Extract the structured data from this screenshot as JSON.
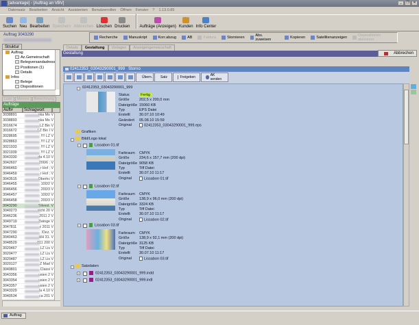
{
  "window": {
    "title": "[advantage] - [Auftrag an VBV]",
    "controls": [
      "_",
      "❐",
      "✕"
    ]
  },
  "menu": [
    "Datensatz",
    "Bearbeiten",
    "Ansicht",
    "Assistenten",
    "Benutzerrollen",
    "Öffnen",
    "Fenster",
    "?",
    "1.13.0.85"
  ],
  "toolbar": [
    {
      "label": "Suchen",
      "enabled": true,
      "color": "#6a8ad0"
    },
    {
      "label": "Neu",
      "enabled": true,
      "color": "#90b8e8"
    },
    {
      "label": "Bearbeiten",
      "enabled": true,
      "color": "#7aa0c0"
    },
    {
      "label": "Speichern",
      "enabled": false,
      "color": "#c0c0c0"
    },
    {
      "label": "Abbrechen",
      "enabled": false,
      "color": "#c0c0c0"
    },
    {
      "label": "Löschen",
      "enabled": true,
      "color": "#e03030"
    },
    {
      "label": "Drucken",
      "enabled": true,
      "color": "#8a8a8a"
    },
    {
      "label": "Aufträge (Anzeigen)",
      "enabled": true,
      "color": "#c04ab0"
    },
    {
      "label": "Kunden",
      "enabled": true,
      "color": "#d0902a"
    },
    {
      "label": "Info Center",
      "enabled": true,
      "color": "#4a80d0"
    }
  ],
  "order": {
    "title": "Auftrag 3043290"
  },
  "toolbar2": [
    {
      "label": "Recherche",
      "enabled": true
    },
    {
      "label": "Manuskript",
      "enabled": true
    },
    {
      "label": "Korr.abzug",
      "enabled": true
    },
    {
      "label": "AB",
      "enabled": true
    },
    {
      "label": "Faktura",
      "enabled": false
    },
    {
      "label": "Stornieren",
      "enabled": true
    },
    {
      "label": "Abs. zuweisen",
      "enabled": true
    },
    {
      "label": "Kopieren",
      "enabled": true
    },
    {
      "label": "Satellitenanzeigen",
      "enabled": true
    },
    {
      "label": "Dispositionen aktivieren",
      "enabled": false
    }
  ],
  "left": {
    "tab": "Struktur",
    "tree": [
      {
        "label": "Auftrag",
        "level": 0
      },
      {
        "label": "Az.Gemeinschaft",
        "level": 1
      },
      {
        "label": "Belegversandadress",
        "level": 1
      },
      {
        "label": "Positionen  (1)",
        "level": 1
      },
      {
        "label": "Details",
        "level": 1
      },
      {
        "label": "Infos",
        "level": 0
      },
      {
        "label": "Belege",
        "level": 1
      },
      {
        "label": "Dispositionen",
        "level": 1
      }
    ],
    "tabs2": [
      "Liste",
      "Memos",
      "Berechnung"
    ],
    "list_title": "Aufträge",
    "columns": [
      "Auft#",
      "Schlagwort"
    ],
    "rows": [
      [
        "3038891",
        "nka Mo V"
      ],
      [
        "3038893",
        "nka Mo V"
      ],
      [
        "3016674",
        "LZ Bin V"
      ],
      [
        "3016672",
        "LZ Bin I V"
      ],
      [
        "3028695",
        "!!!! LZ V"
      ],
      [
        "3028863",
        "!!!! LZ V"
      ],
      [
        "3021933",
        "!!!! LZ V"
      ],
      [
        "3021939",
        "!!!! LZ V"
      ],
      [
        "3043330",
        "da 4.10 V"
      ],
      [
        "3042607",
        "200/6 ; V"
      ],
      [
        "3046460",
        "r Hof ; V"
      ],
      [
        "3046459",
        "r Hof ; V"
      ],
      [
        "3043515",
        "Oberhc V"
      ],
      [
        "3046455",
        "100/2 V"
      ],
      [
        "3046456",
        "200/3 V"
      ],
      [
        "3046457",
        "100/2 V"
      ],
      [
        "3046458",
        "200/3 V"
      ],
      [
        "3043290",
        "Silvest. V"
      ],
      [
        "3040273",
        "sicht 20 V"
      ],
      [
        "3046236",
        "2011 2 V"
      ],
      [
        "3049719",
        "Zwinge V"
      ],
      [
        "3047811",
        "z 2011 V"
      ],
      [
        "3047290",
        "/Dez. V"
      ],
      [
        "3040463",
        "HH 31. V"
      ],
      [
        "3048529",
        "011 200 V"
      ],
      [
        "3020467",
        "LZ Lis V"
      ],
      [
        "3020477",
        "LZ Lis V"
      ],
      [
        "3020487",
        "LZ Lis V"
      ],
      [
        "3020127",
        "Z Mad V"
      ],
      [
        "3049801",
        "Classi V"
      ],
      [
        "3043356",
        "usien 2 V"
      ],
      [
        "3043354",
        "usien 2 V"
      ],
      [
        "3043357",
        "usien 2 V"
      ],
      [
        "3043329",
        "la 4.10 V"
      ],
      [
        "3040534",
        "ca 201 V"
      ]
    ],
    "selected": "3043290"
  },
  "taskbar": {
    "item": "Auftrag"
  },
  "right": {
    "tabs": [
      "Details",
      "Gestaltung",
      "Vorlagen",
      "Anzeigengemeinschaft"
    ],
    "active_tab": "Gestaltung",
    "section_title": "Gestaltung",
    "cancel": "Abbrechen",
    "header": {
      "name": "02412353_03043290001_999",
      "status": "Storno"
    },
    "actions": [
      "Übern.",
      "Satz",
      "Freigeben",
      "AK senden"
    ],
    "main": {
      "name": "02412353_03043290001_999",
      "fields": [
        [
          "Status",
          "Fertig"
        ],
        [
          "Größe",
          "202,5 x 200,0 mm"
        ],
        [
          "Dateigröße",
          "15060 KB"
        ],
        [
          "Typ",
          "EPS Datei"
        ],
        [
          "Erstellt",
          "30.07.10 10:49"
        ],
        [
          "Geändert",
          "05.08.10 15:59"
        ],
        [
          "Original",
          "02412353_03043290001_999.eps"
        ]
      ]
    },
    "folders": {
      "grafiken": "Grafiken",
      "bild": "Bild/Logo lokal",
      "satz": "Satzdaten"
    },
    "images": [
      {
        "name": "Lissabon 01.tif",
        "fields": [
          [
            "Farbraum",
            "CMYK"
          ],
          [
            "Größe",
            "234,6 x 157,7 mm (200 dpi)"
          ],
          [
            "Dateigröße",
            "9058 KB"
          ],
          [
            "Typ",
            "Tiff Datei"
          ],
          [
            "Erstellt",
            "30.07.10 11:17"
          ],
          [
            "Original",
            "Lissabon 01.tif"
          ]
        ]
      },
      {
        "name": "Lissabon 02.tif",
        "fields": [
          [
            "Farbraum",
            "CMYK"
          ],
          [
            "Größe",
            "138,9 x 96,0 mm (200 dpi)"
          ],
          [
            "Dateigröße",
            "3324 KB"
          ],
          [
            "Typ",
            "Tiff Datei"
          ],
          [
            "Erstellt",
            "30.07.10 11:17"
          ],
          [
            "Original",
            "Lissabon 02.tif"
          ]
        ]
      },
      {
        "name": "Lissabon 03.tif",
        "fields": [
          [
            "Farbraum",
            "CMYK"
          ],
          [
            "Größe",
            "138,9 x 92,1 mm (200 dpi)"
          ],
          [
            "Dateigröße",
            "3125 KB"
          ],
          [
            "Typ",
            "Tiff Datei"
          ],
          [
            "Erstellt",
            "30.07.10 11:17"
          ],
          [
            "Original",
            "Lissabon 03.tif"
          ]
        ]
      }
    ],
    "satz": [
      "02412353_03043290001_999.indd",
      "02412353_03043290001_999.indl"
    ]
  }
}
